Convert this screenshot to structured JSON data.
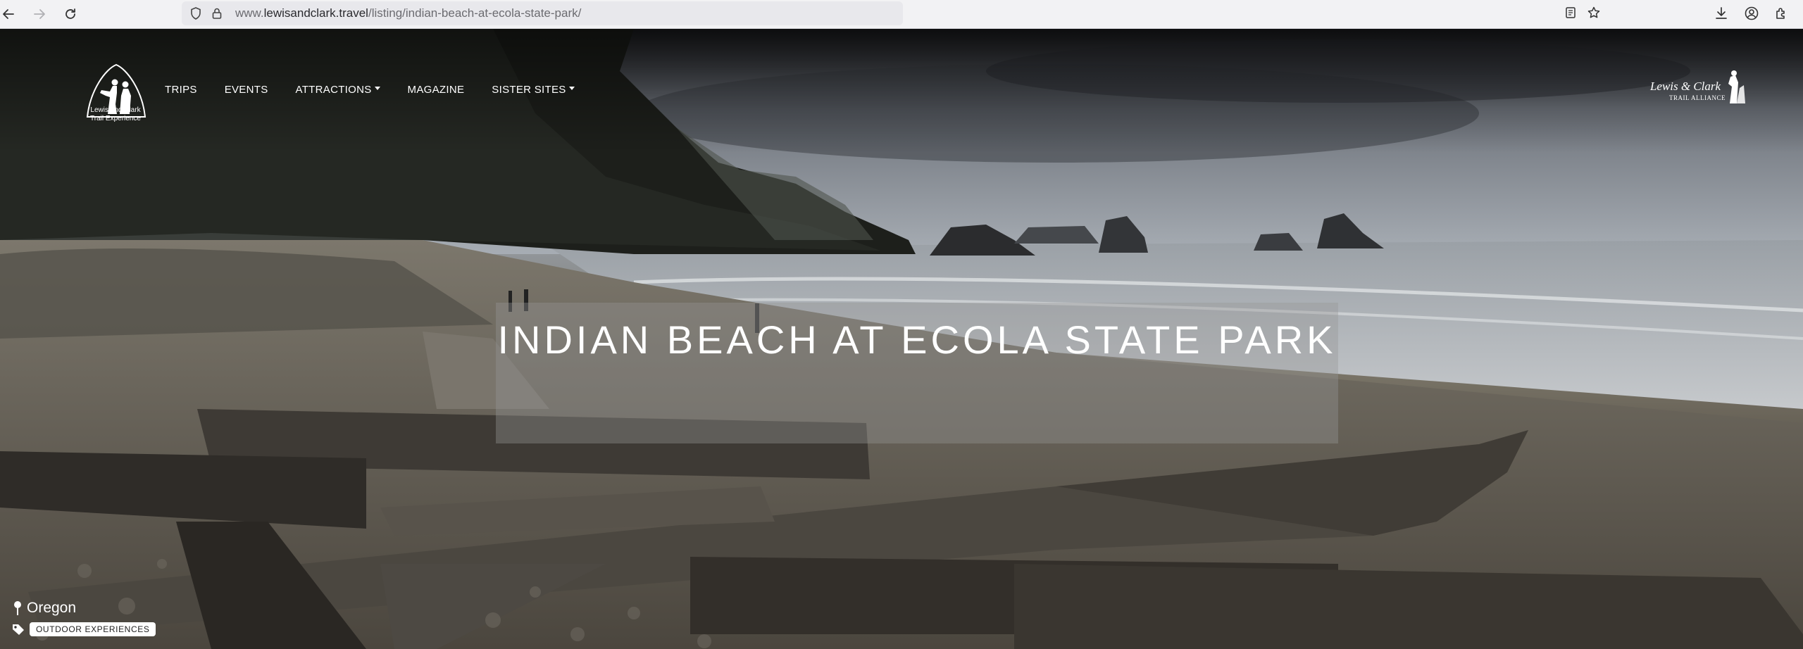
{
  "browser": {
    "url_prefix": "www.",
    "url_host": "lewisandclark.travel",
    "url_path": "/listing/indian-beach-at-ecola-state-park/"
  },
  "site": {
    "logo_caption_line1": "Lewis and Clark",
    "logo_caption_line2": "Trail Experience",
    "nav": [
      {
        "label": "TRIPS",
        "dropdown": false
      },
      {
        "label": "EVENTS",
        "dropdown": false
      },
      {
        "label": "ATTRACTIONS",
        "dropdown": true
      },
      {
        "label": "MAGAZINE",
        "dropdown": false
      },
      {
        "label": "SISTER SITES",
        "dropdown": true
      }
    ],
    "alliance_script": "Lewis & Clark",
    "alliance_sub": "TRAIL ALLIANCE"
  },
  "listing": {
    "title": "INDIAN BEACH AT ECOLA STATE PARK",
    "location": "Oregon",
    "tag": "OUTDOOR EXPERIENCES"
  },
  "icons": {
    "back": "arrow-left-icon",
    "forward": "arrow-right-icon",
    "reload": "reload-icon",
    "shield": "shield-icon",
    "lock": "lock-icon",
    "reader": "reader-view-icon",
    "bookmark": "star-icon",
    "download": "download-icon",
    "account": "account-icon",
    "extensions": "extensions-icon",
    "pin": "map-pin-icon",
    "tag": "tag-icon"
  }
}
